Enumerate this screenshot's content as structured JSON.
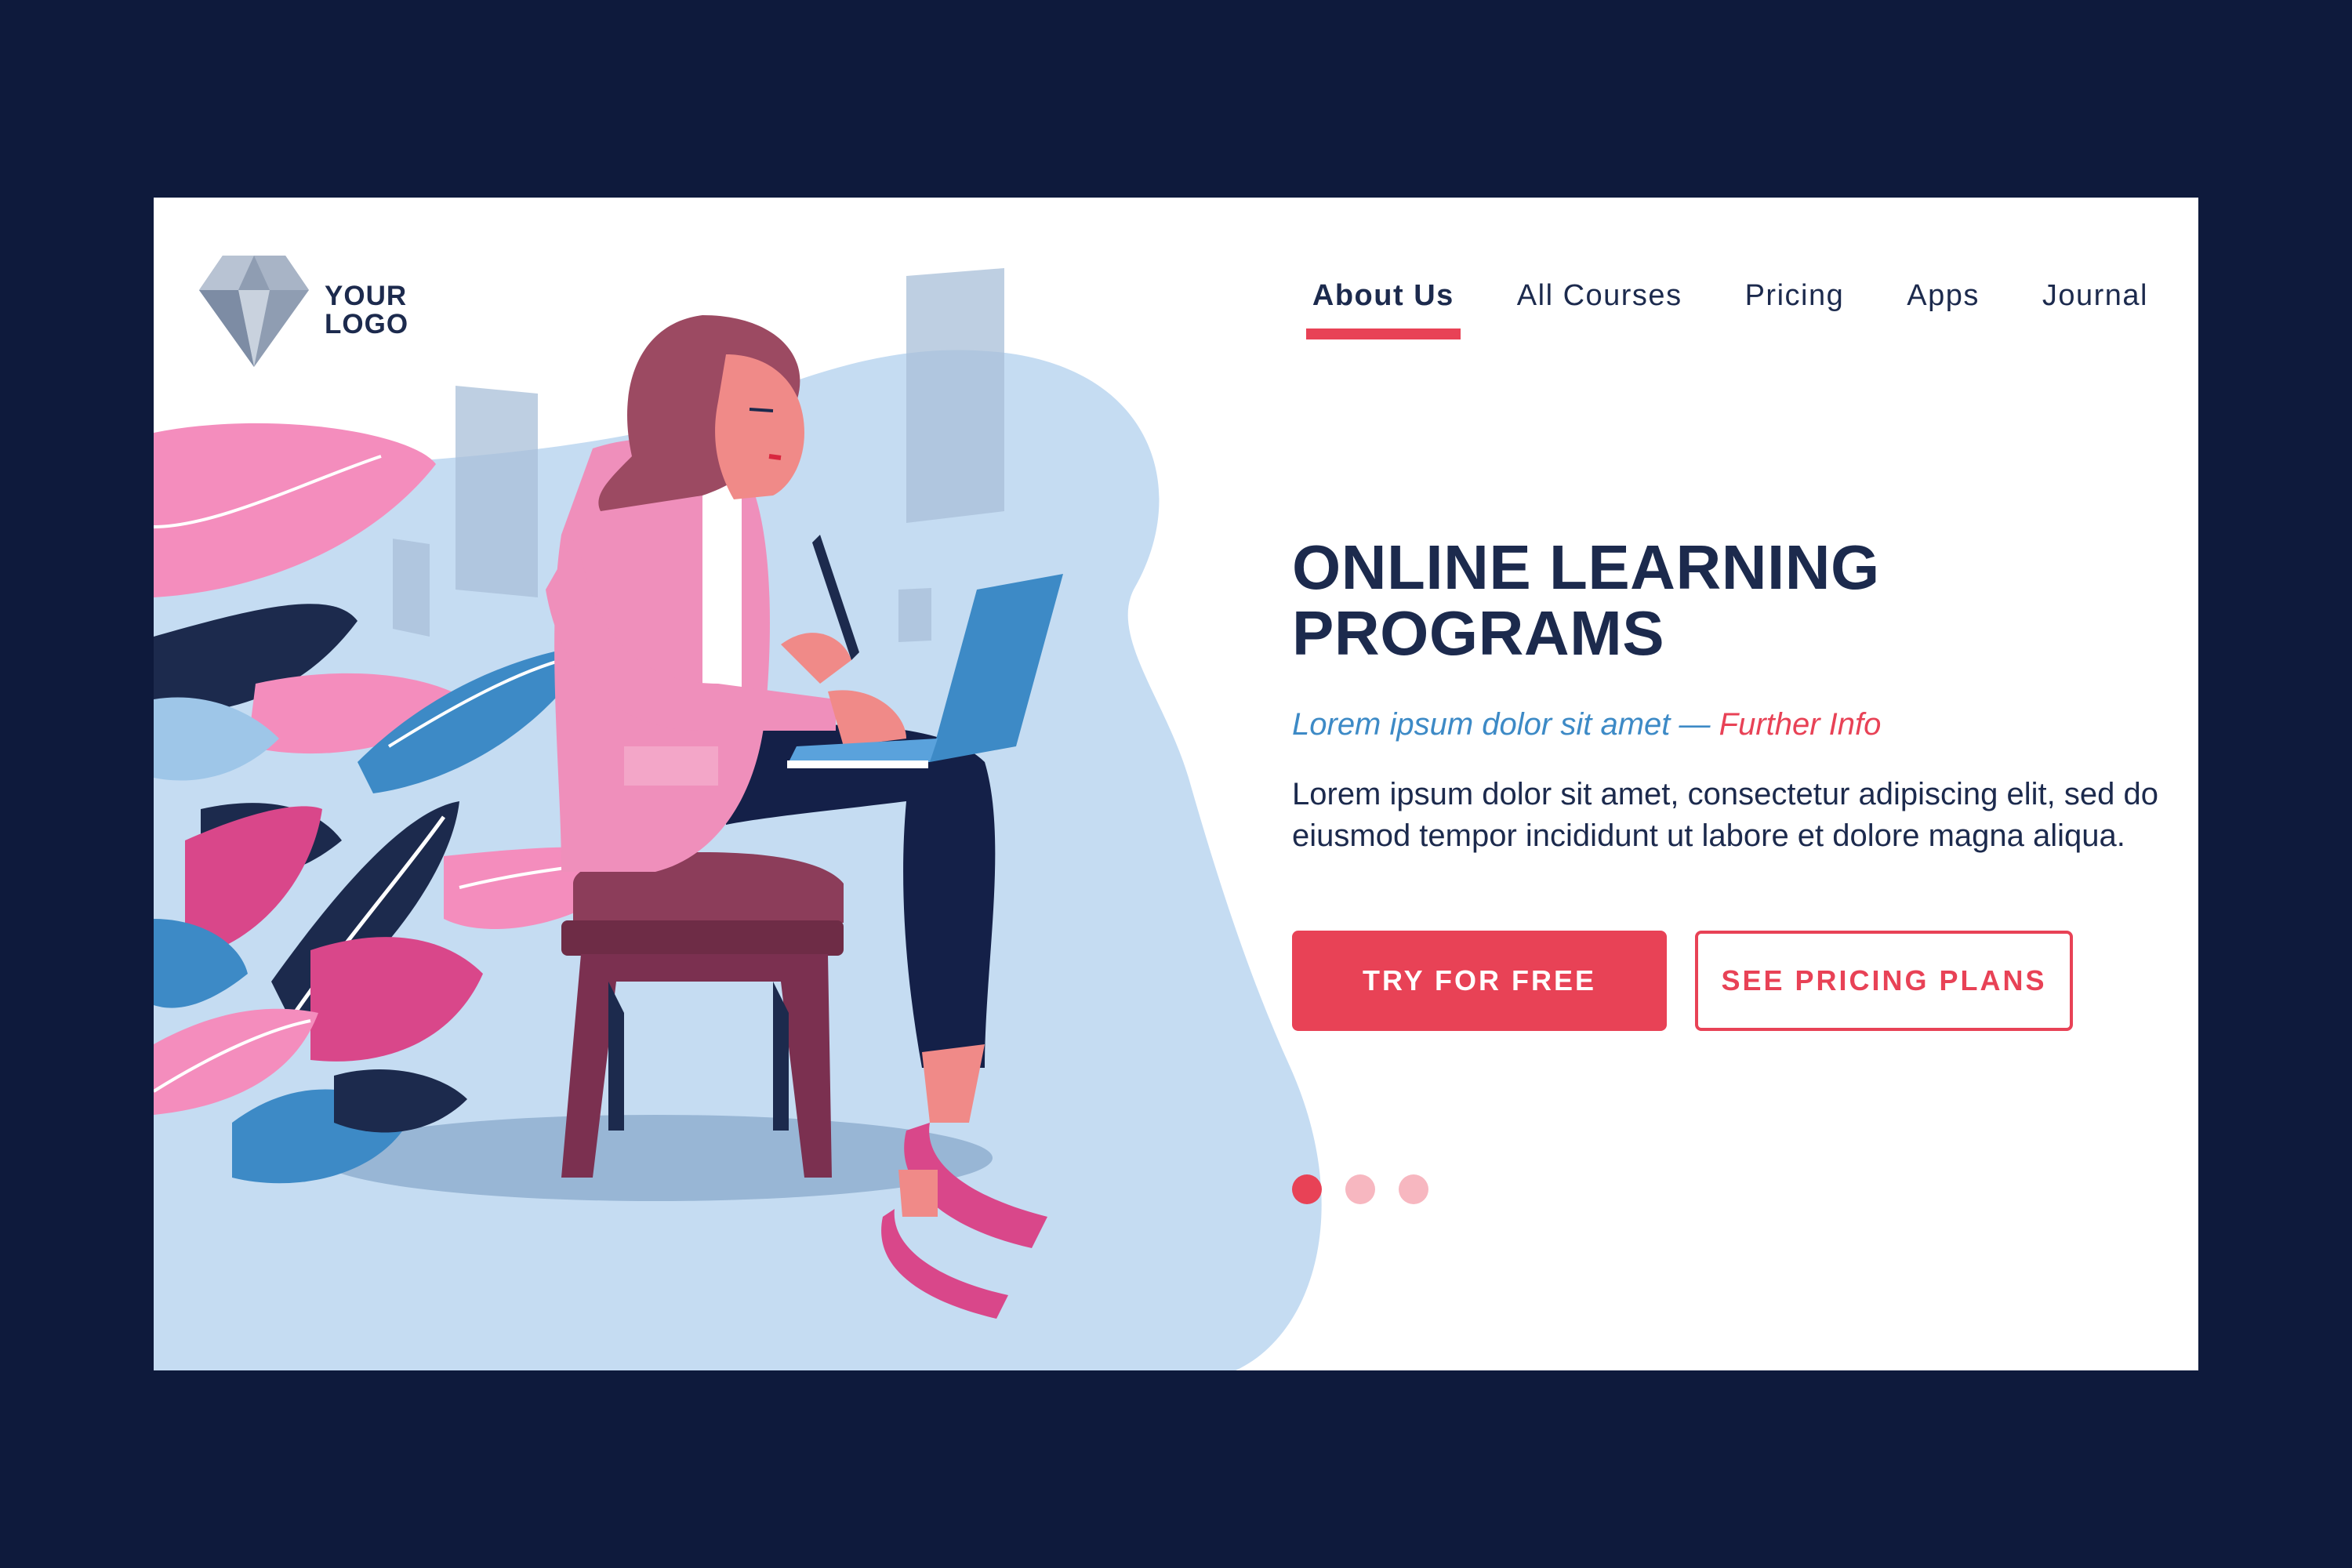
{
  "logo": {
    "line1": "YOUR",
    "line2": "LOGO"
  },
  "nav": {
    "items": [
      {
        "label": "About Us",
        "active": true
      },
      {
        "label": "All Courses",
        "active": false
      },
      {
        "label": "Pricing",
        "active": false
      },
      {
        "label": "Apps",
        "active": false
      },
      {
        "label": "Journal",
        "active": false
      }
    ]
  },
  "hero": {
    "title_line1": "ONLINE LEARNING",
    "title_line2": "PROGRAMS",
    "subtitle": "Lorem ipsum dolor sit amet —",
    "subtitle_link": "Further Info",
    "description": "Lorem ipsum dolor sit amet, consectetur adipiscing elit, sed do eiusmod tempor incididunt ut labore et dolore magna aliqua."
  },
  "buttons": {
    "primary": "TRY FOR FREE",
    "secondary": "SEE PRICING PLANS"
  },
  "carousel": {
    "count": 3,
    "active_index": 0
  },
  "colors": {
    "background": "#0e1a3c",
    "navy": "#1c2a4d",
    "accent": "#e84256",
    "blue": "#3d8ac6",
    "light_blue": "#c5dcf2"
  },
  "icons": [
    "diamond-logo-icon"
  ]
}
